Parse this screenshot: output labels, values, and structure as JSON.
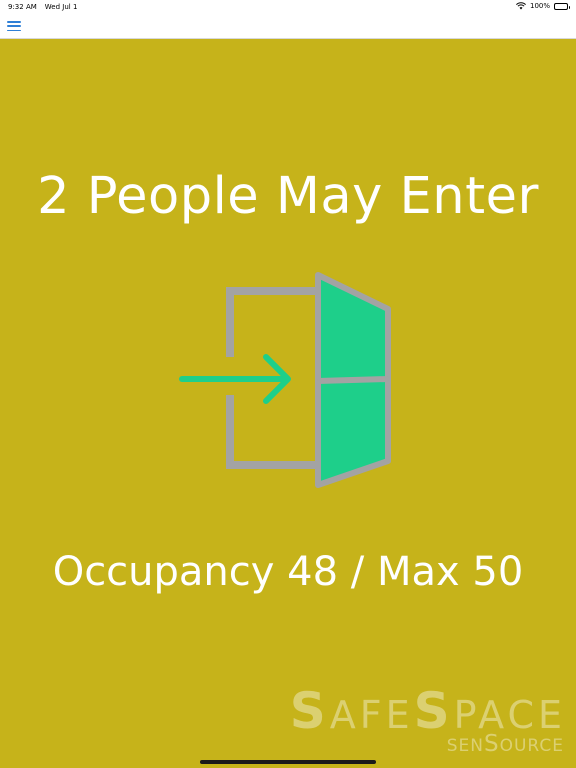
{
  "status_bar": {
    "time": "9:32 AM",
    "date": "Wed Jul 1",
    "battery": "100%",
    "battery_level": 1.0,
    "icons": [
      "wifi-icon",
      "battery-icon"
    ]
  },
  "nav": {
    "menu_icon": "hamburger-menu-icon",
    "menu_color": "#2f7fd6"
  },
  "main": {
    "background_color": "#c6b31a",
    "headline": "2 People May Enter",
    "door_icon": "enter-door-icon",
    "door_color": "#1ecf8a",
    "frame_color": "#a3a3a3",
    "occupancy_text": "Occupancy 48 / Max 50",
    "occupancy": 48,
    "max": 50
  },
  "logo": {
    "main": [
      "S",
      "AFE",
      "S",
      "PACE"
    ],
    "sub": [
      "SEN",
      "S",
      "OURCE"
    ]
  }
}
